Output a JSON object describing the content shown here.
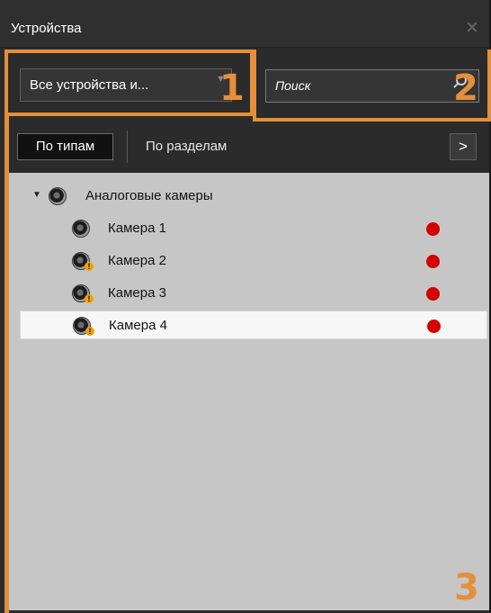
{
  "window": {
    "title": "Устройства",
    "close_symbol": "✕"
  },
  "filters": {
    "device_filter_value": "Все устройства и...",
    "search_placeholder": "Поиск",
    "callout_1": "1",
    "callout_2": "2"
  },
  "tabs": {
    "by_types": "По типам",
    "by_sections": "По разделам",
    "next_symbol": ">"
  },
  "tree": {
    "group": {
      "label": "Аналоговые камеры",
      "expanded": true
    },
    "items": [
      {
        "label": "Камера 1",
        "warning": false,
        "status_color": "#d40000"
      },
      {
        "label": "Камера 2",
        "warning": true,
        "status_color": "#d40000"
      },
      {
        "label": "Камера 3",
        "warning": true,
        "status_color": "#d40000"
      },
      {
        "label": "Камера 4",
        "warning": true,
        "status_color": "#d40000",
        "selected": true
      }
    ]
  },
  "callout_3": "3",
  "colors": {
    "accent": "#e48f3a",
    "tree_bg": "#c6c6c6",
    "dark_bg": "#2b2b2b",
    "status_red": "#d40000"
  },
  "icons": [
    "close-icon",
    "dropdown-arrow-icon",
    "search-icon",
    "chevron-right-icon",
    "camera-icon",
    "warning-icon"
  ]
}
